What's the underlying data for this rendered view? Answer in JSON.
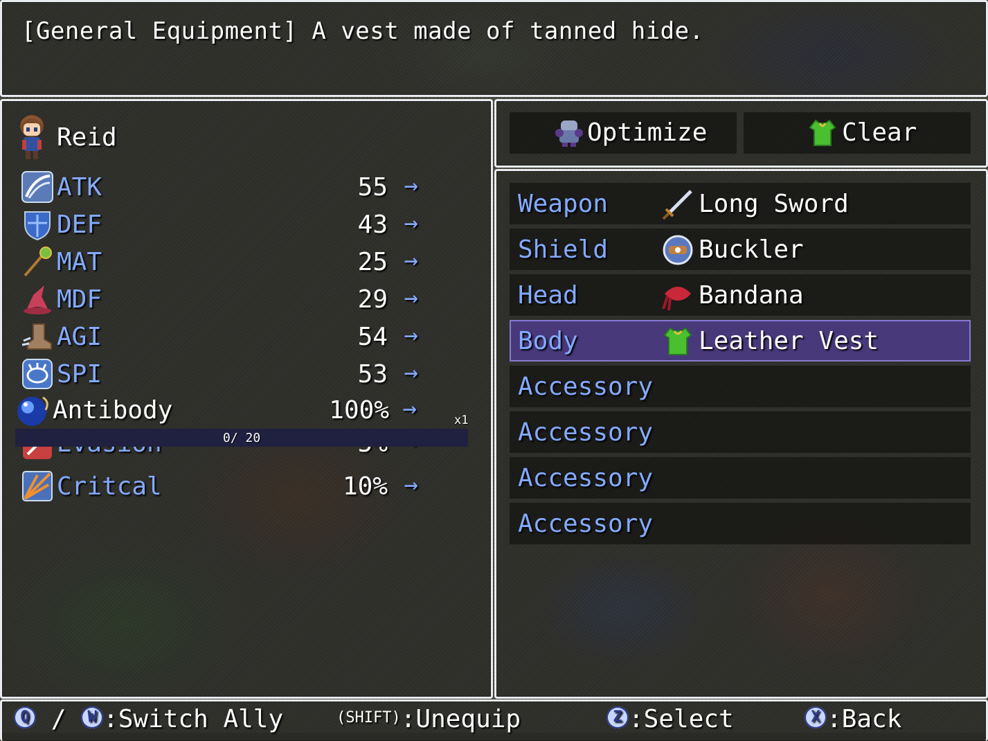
{
  "help": {
    "text": "[General Equipment] A vest made of tanned hide."
  },
  "actor": {
    "name": "Reid",
    "sprite_icon": "hero-sprite-icon"
  },
  "stats": [
    {
      "label": "ATK",
      "value": "55",
      "arrow": "→",
      "icon": "sword-slash-icon",
      "color": "#5a7ab8"
    },
    {
      "label": "DEF",
      "value": "43",
      "arrow": "→",
      "icon": "shield-icon",
      "color": "#3b6ac8"
    },
    {
      "label": "MAT",
      "value": "25",
      "arrow": "→",
      "icon": "magic-staff-icon",
      "color": "#c8a040"
    },
    {
      "label": "MDF",
      "value": "29",
      "arrow": "→",
      "icon": "wizard-hat-icon",
      "color": "#c8405a"
    },
    {
      "label": "AGI",
      "value": "54",
      "arrow": "→",
      "icon": "boot-icon",
      "color": "#a08060"
    },
    {
      "label": "SPI",
      "value": "53",
      "arrow": "→",
      "icon": "spirit-icon",
      "color": "#4a78c8"
    },
    {
      "label": "Critcal",
      "value": "10%",
      "arrow": "→",
      "icon": "critical-burst-icon",
      "color": "#e08030"
    }
  ],
  "overlay": {
    "label": "Antibody",
    "value": "100%",
    "arrow": "→",
    "multiplier": "x1",
    "gauge_text": "0/ 20",
    "icon": "blue-orb-icon"
  },
  "hidden_row": {
    "label": "Evasion",
    "value": "5%"
  },
  "commands": [
    {
      "label": "Optimize",
      "icon": "armor-optimize-icon"
    },
    {
      "label": "Clear",
      "icon": "vest-clear-icon"
    }
  ],
  "slots": [
    {
      "name": "Weapon",
      "item": "Long Sword",
      "icon": "long-sword-icon"
    },
    {
      "name": "Shield",
      "item": "Buckler",
      "icon": "buckler-icon"
    },
    {
      "name": "Head",
      "item": "Bandana",
      "icon": "bandana-icon"
    },
    {
      "name": "Body",
      "item": "Leather Vest",
      "icon": "leather-vest-icon",
      "selected": true
    },
    {
      "name": "Accessory",
      "item": ""
    },
    {
      "name": "Accessory",
      "item": ""
    },
    {
      "name": "Accessory",
      "item": ""
    },
    {
      "name": "Accessory",
      "item": ""
    }
  ],
  "footer": {
    "q_key": "Q",
    "slash": "/",
    "w_key": "W",
    "switch": ":Switch Ally",
    "shift_key": "(SHIFT)",
    "unequip": ":Unequip",
    "z_key": "Z",
    "select": ":Select",
    "x_key": "X",
    "back": ":Back"
  }
}
